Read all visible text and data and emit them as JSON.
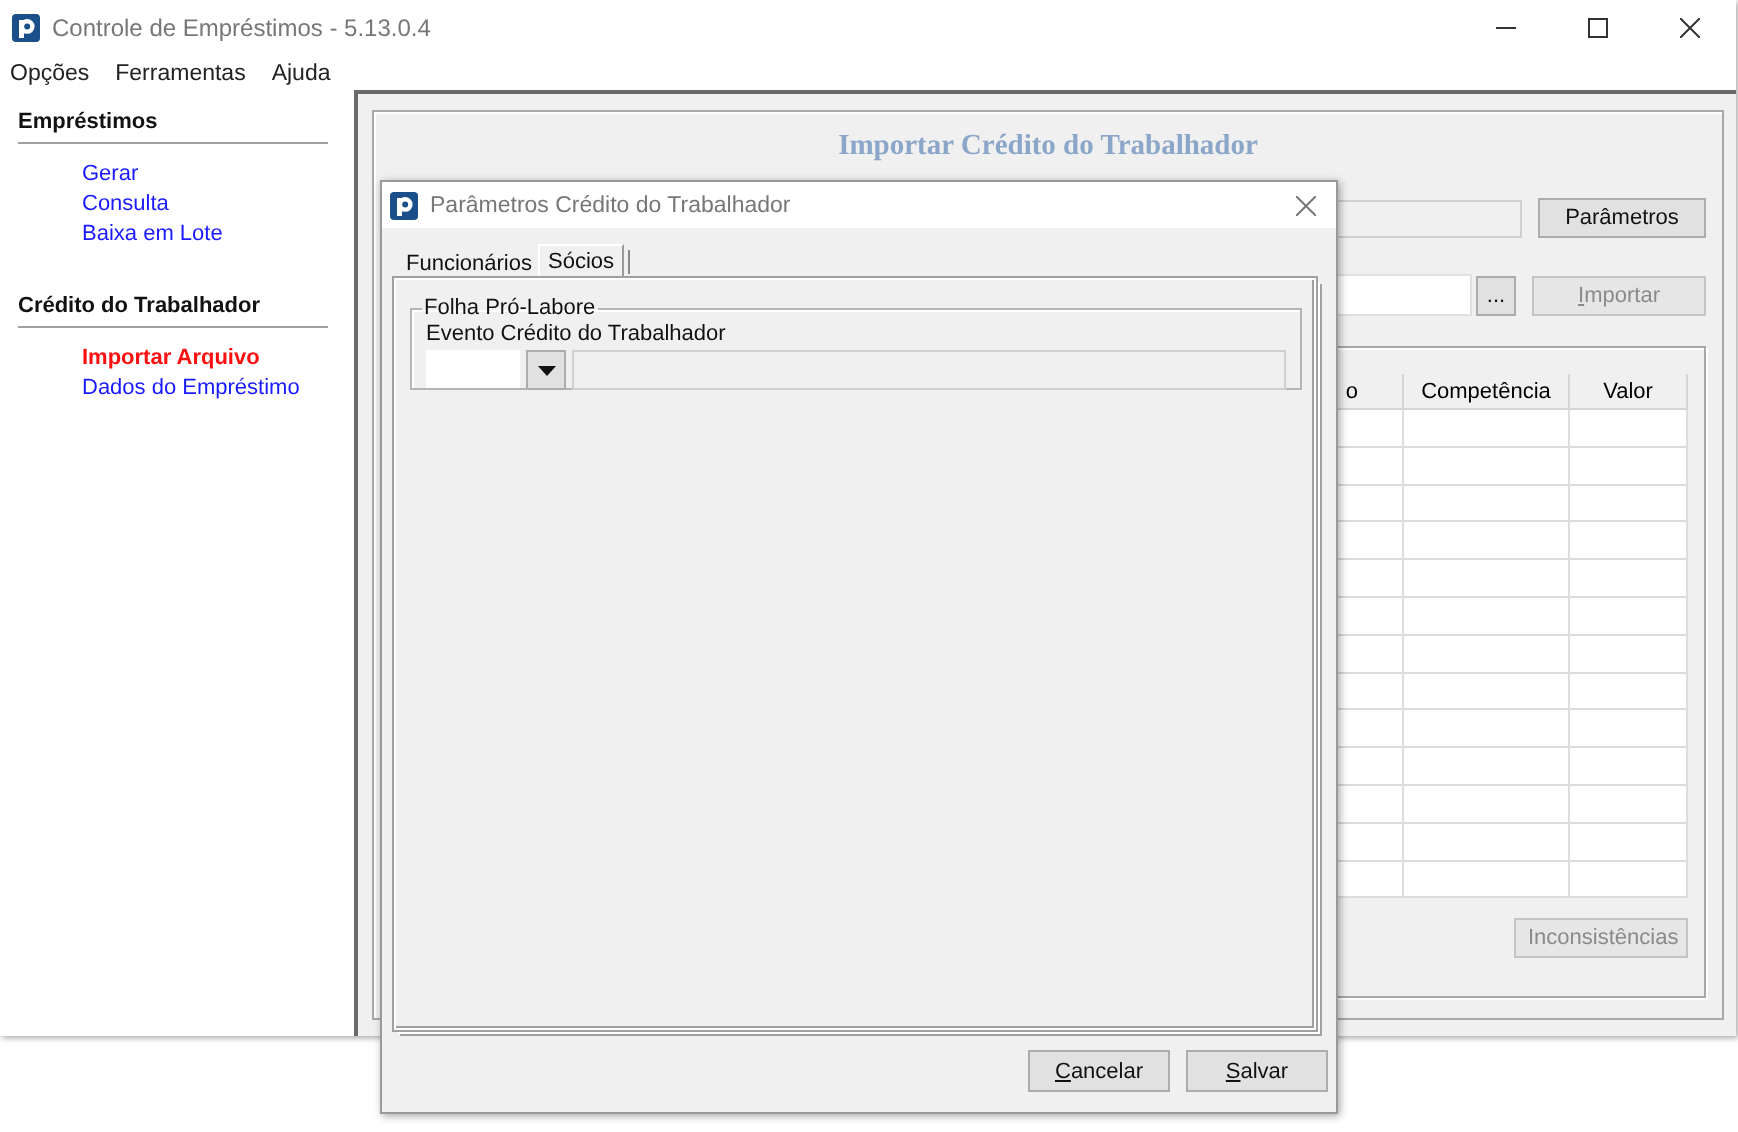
{
  "window": {
    "title": "Controle de Empréstimos - 5.13.0.4"
  },
  "menu": [
    "Opções",
    "Ferramentas",
    "Ajuda"
  ],
  "sidebar": {
    "sections": [
      {
        "title": "Empréstimos",
        "items": [
          {
            "label": "Gerar",
            "selected": false
          },
          {
            "label": "Consulta",
            "selected": false
          },
          {
            "label": "Baixa em Lote",
            "selected": false
          }
        ]
      },
      {
        "title": "Crédito do Trabalhador",
        "items": [
          {
            "label": "Importar Arquivo",
            "selected": true
          },
          {
            "label": "Dados do Empréstimo",
            "selected": false
          }
        ]
      }
    ]
  },
  "panel": {
    "title": "Importar Crédito do Trabalhador",
    "parameters_button": {
      "label": "Parâmetros",
      "disabled": false
    },
    "browse_button": {
      "label": "...",
      "disabled": false
    },
    "import_button": {
      "label": "Importar",
      "disabled": true
    },
    "table": {
      "columns": [
        "o",
        "Competência",
        "Valor"
      ]
    },
    "inconsistencies_button": {
      "label": "Inconsistências",
      "disabled": true
    }
  },
  "dialog": {
    "title": "Parâmetros Crédito do Trabalhador",
    "tabs": [
      {
        "label": "Funcionários",
        "selected": false
      },
      {
        "label": "Sócios",
        "selected": true
      }
    ],
    "group": {
      "title": "Folha Pró-Labore",
      "field_label": "Evento Crédito do Trabalhador"
    },
    "buttons": [
      "Cancelar",
      "Salvar"
    ]
  }
}
